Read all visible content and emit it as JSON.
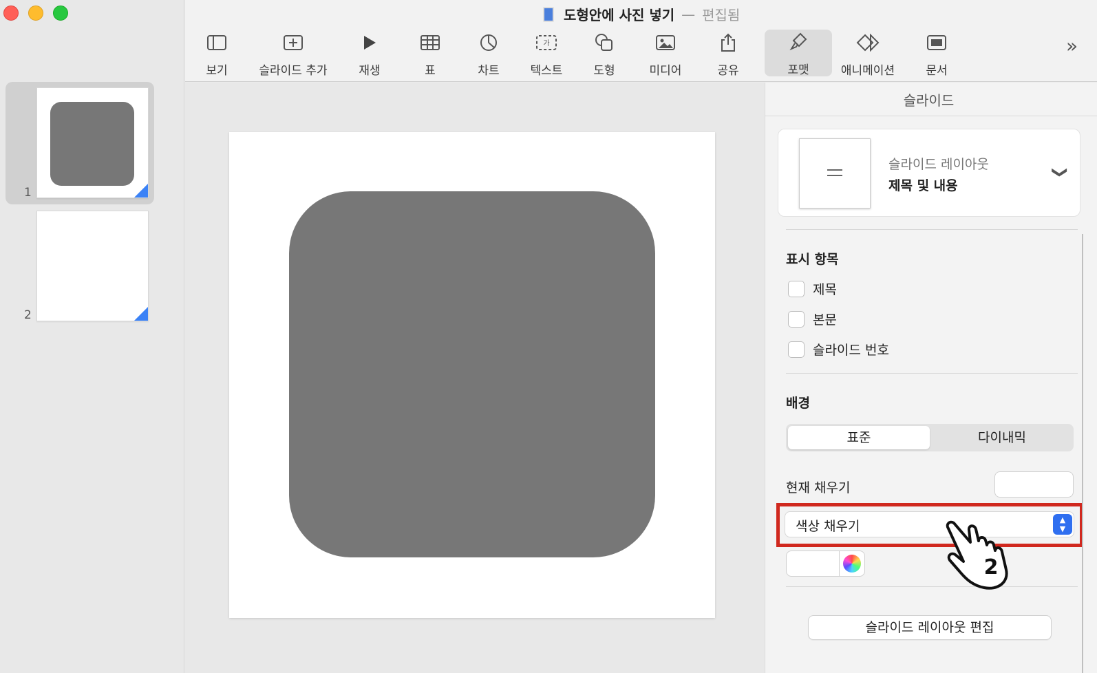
{
  "window": {
    "title": "도형안에 사진 넣기",
    "separator": "—",
    "state": "편집됨"
  },
  "toolbar": {
    "items": [
      {
        "label": "보기",
        "icon": "sidebar-icon"
      },
      {
        "label": "슬라이드 추가",
        "icon": "add-slide-icon"
      },
      {
        "label": "재생",
        "icon": "play-icon"
      },
      {
        "label": "표",
        "icon": "table-icon"
      },
      {
        "label": "차트",
        "icon": "chart-icon"
      },
      {
        "label": "텍스트",
        "icon": "text-box-icon"
      },
      {
        "label": "도형",
        "icon": "shape-icon"
      },
      {
        "label": "미디어",
        "icon": "media-icon"
      },
      {
        "label": "공유",
        "icon": "share-icon"
      },
      {
        "label": "포맷",
        "icon": "format-brush-icon",
        "active": true
      },
      {
        "label": "애니메이션",
        "icon": "animate-icon"
      },
      {
        "label": "문서",
        "icon": "document-icon"
      }
    ],
    "more": "»"
  },
  "navigator": {
    "slides": [
      {
        "number": "1",
        "selected": true
      },
      {
        "number": "2",
        "selected": false
      }
    ]
  },
  "inspector": {
    "title": "슬라이드",
    "layout": {
      "sublabel": "슬라이드 레이아웃",
      "value": "제목 및 내용"
    },
    "show_section": {
      "label": "표시 항목",
      "items": [
        "제목",
        "본문",
        "슬라이드 번호"
      ]
    },
    "background": {
      "label": "배경",
      "segments": [
        "표준",
        "다이내믹"
      ],
      "selected_segment": "표준",
      "current_fill_label": "현재 채우기",
      "fill_type": "색상 채우기"
    },
    "edit_layout_button": "슬라이드 레이아웃 편집"
  },
  "annotation": {
    "step_number": "2",
    "highlight_color": "#d0281e"
  },
  "colors": {
    "accent": "#2f6ff0",
    "shape_fill": "#777777"
  }
}
